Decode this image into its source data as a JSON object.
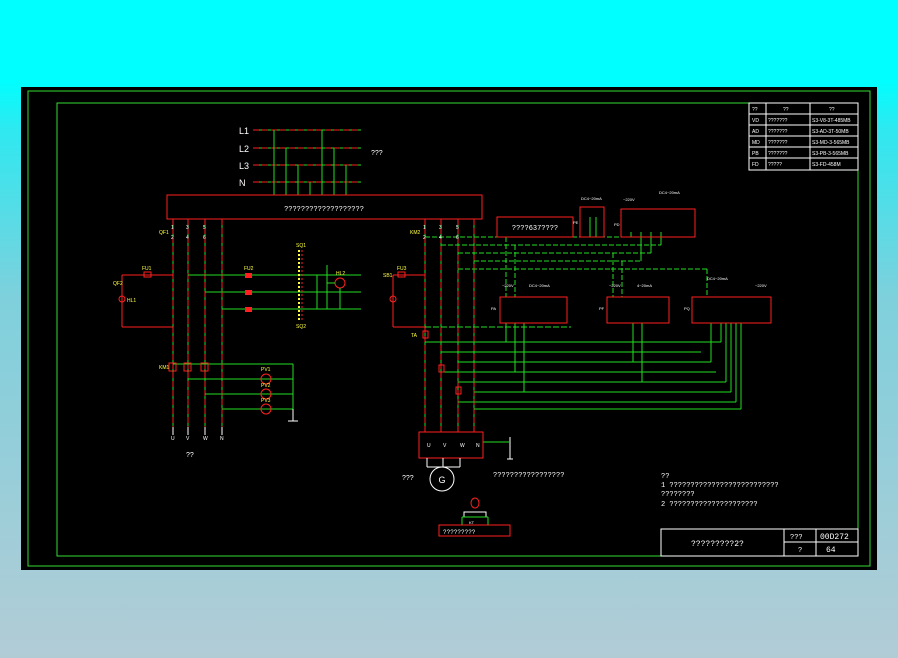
{
  "bus": {
    "lines": [
      "L1",
      "L2",
      "L3",
      "N"
    ],
    "power_label": "???"
  },
  "top_box_label": "???????????????????",
  "box_mid_label": "????637????",
  "motor_terminals_label": "?????????????????",
  "motor_symbol": "G",
  "motor_label": "???",
  "sensor_box_label": "?????????",
  "left_bottom_label": "??",
  "left_terminals": [
    "U",
    "V",
    "W",
    "N"
  ],
  "motor_box_terminals": [
    "U",
    "V",
    "W",
    "N"
  ],
  "refs": {
    "qf1": "QF1",
    "qf2": "QF2",
    "km1": "KM1",
    "km2": "KM2",
    "fu1": "FU1",
    "fu2": "FU2",
    "fu3": "FU3",
    "hl1": "HL1",
    "hl2": "HL2",
    "ta": "TA",
    "pv1": "PV1",
    "pv2": "PV2",
    "pv3": "PV3",
    "sq1": "SQ1",
    "sq2": "SQ2",
    "sb1": "SB1",
    "kt": "KT"
  },
  "terminal_numbers": [
    "1",
    "3",
    "5",
    "2",
    "4",
    "6"
  ],
  "devices": {
    "pm1": {
      "ac": "~220V",
      "dc": "DC4~20mA",
      "ref": "PA"
    },
    "pm2": {
      "ac": "~220V",
      "dc": "4~20mA",
      "ref": "PF"
    },
    "pm3": {
      "ac": "~220V",
      "dc": "DC4~20mA",
      "ref": "PQ"
    },
    "top_small": {
      "dc": "DC4~20mA",
      "ref": "PE"
    },
    "top_right": {
      "ac": "~220V",
      "dc": "DC4~20mA",
      "ref": "PD"
    }
  },
  "table": {
    "headers": [
      "??",
      "??",
      "??"
    ],
    "rows": [
      [
        "VD",
        "???????",
        "S3-V8-3T-485MB"
      ],
      [
        "AD",
        "???????",
        "S3-AD-3T-50MB"
      ],
      [
        "MD",
        "???????",
        "S3-MD-3-565MB"
      ],
      [
        "PB",
        "???????",
        "S3-PB-3-565MB"
      ],
      [
        "FD",
        "?????",
        "S3-FD-458M"
      ]
    ]
  },
  "notes": {
    "title": "??",
    "items": [
      "1  ??????????????????????????",
      "    ????????",
      "2  ?????????????????????"
    ]
  },
  "title_block": {
    "name": "?????????2?",
    "label1": "???",
    "code": "00D272",
    "label2": "?",
    "sheet": "64"
  },
  "colors": {
    "background": "#000000",
    "border": "#33dd33",
    "wire_red": "#ff2020",
    "wire_green": "#22dd22",
    "text": "#ffffff",
    "yellow": "#ffff40",
    "cyan": "#00ffff"
  }
}
